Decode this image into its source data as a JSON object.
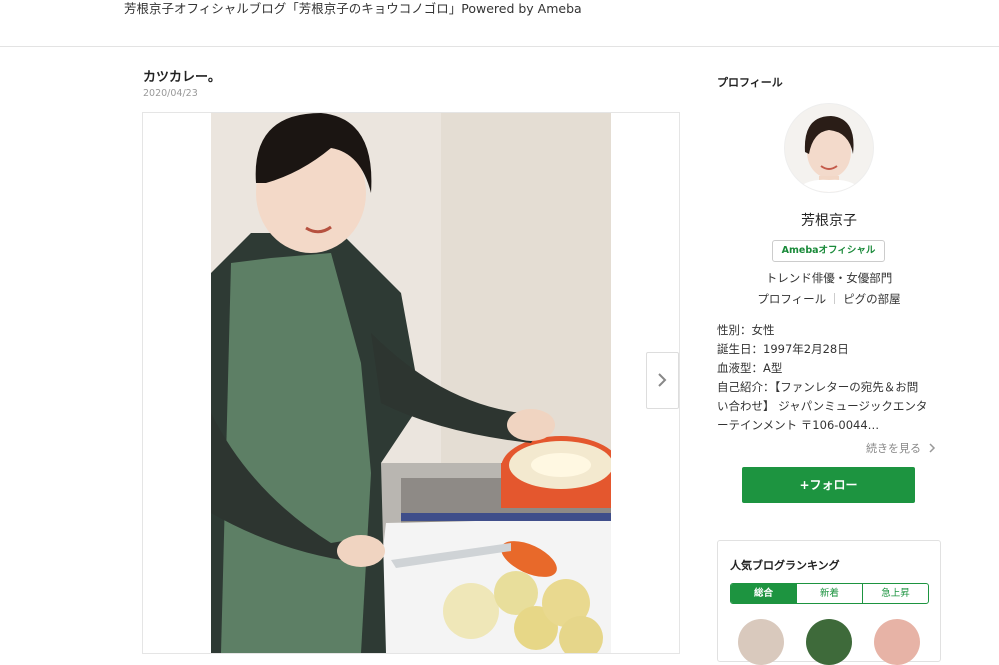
{
  "header": {
    "blog_title": "芳根京子オフィシャルブログ「芳根京子のキョウコノゴロ」Powered by Ameba"
  },
  "post": {
    "title": "カツカレー。",
    "date": "2020/04/23"
  },
  "profile": {
    "heading": "プロフィール",
    "name": "芳根京子",
    "badge": "Amebaオフィシャル",
    "category": "トレンド俳優・女優部門",
    "link_profile": "プロフィール",
    "link_room": "ピグの部屋",
    "gender": "性別：女性",
    "birthday": "誕生日：1997年2月28日",
    "blood": "血液型：A型",
    "intro_line1": "自己紹介：【ファンレターの宛先＆お問",
    "intro_line2": "い合わせ】 ジャパンミュージックエンタ",
    "intro_line3": "ーテインメント 〒106-0044…",
    "more": "続きを見る",
    "follow": "+フォロー"
  },
  "ranking": {
    "title": "人気ブログランキング",
    "tabs": [
      "総合",
      "新着",
      "急上昇"
    ]
  },
  "colors": {
    "accent_green": "#1d9440"
  }
}
